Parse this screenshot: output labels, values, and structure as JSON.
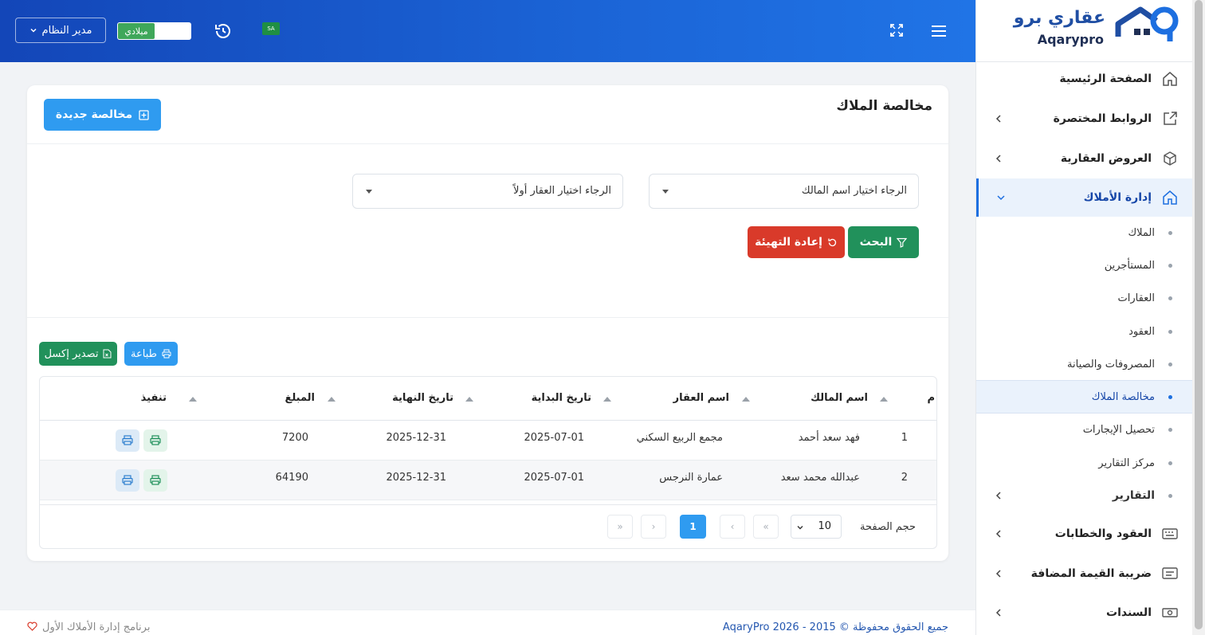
{
  "header": {
    "user_label": "مدير النظام",
    "toggle_label": "ميلادي",
    "flag_text": "SA"
  },
  "sidebar": {
    "logo_ar": "عقاري برو",
    "logo_en": "Aqarypro",
    "items": [
      {
        "label": "الصفحة الرئيسية",
        "icon": "home-icon"
      },
      {
        "label": "الروابط المختصرة",
        "icon": "external-link-icon"
      },
      {
        "label": "العروض العقارية",
        "icon": "box-icon"
      },
      {
        "label": "إدارة الأملاك",
        "icon": "home-icon"
      }
    ],
    "sub_items": [
      "الملاك",
      "المستأجرين",
      "العقارات",
      "العقود",
      "المصروفات والصيانة",
      "مخالصة الملاك",
      "تحصيل الإيجارات",
      "مركز التقارير",
      "التقارير"
    ],
    "bottom_items": [
      {
        "label": "العقود والخطابات",
        "icon": "keyboard-icon"
      },
      {
        "label": "ضريبة القيمة المضافة",
        "icon": "message-icon"
      },
      {
        "label": "السندات",
        "icon": "money-icon"
      }
    ]
  },
  "page": {
    "title": "مخالصة الملاك",
    "new_button": "مخالصة جديدة",
    "owner_select": "الرجاء اختيار اسم المالك",
    "property_select": "الرجاء اختيار العقار أولاً",
    "search_button": "البحث",
    "reset_button": "إعادة التهيئة",
    "print_button": "طباعة",
    "excel_button": "تصدير إكسل"
  },
  "table": {
    "headers": [
      "م",
      "اسم المالك",
      "اسم العقار",
      "تاريخ البداية",
      "تاريخ النهاية",
      "المبلغ",
      "تنفيذ"
    ],
    "rows": [
      [
        "1",
        "فهد سعد أحمد",
        "مجمع الربيع السكني",
        "2025-07-01",
        "2025-12-31",
        "7200"
      ],
      [
        "2",
        "عبدالله محمد سعد",
        "عمارة النرجس",
        "2025-07-01",
        "2025-12-31",
        "64190"
      ]
    ]
  },
  "pager": {
    "label": "حجم الصفحة",
    "size": "10",
    "current": "1",
    "first": "«",
    "prev": "‹",
    "next": "›",
    "last": "»"
  },
  "footer": {
    "copyright": "جميع الحقوق محفوظة © 2015 - 2026 AqaryPro",
    "tagline": "برنامج إدارة الأملاك الأول"
  },
  "colors": {
    "primary": "#1d6fe0",
    "success": "#21915b",
    "danger": "#d93a2a",
    "info": "#2f9bf0"
  }
}
